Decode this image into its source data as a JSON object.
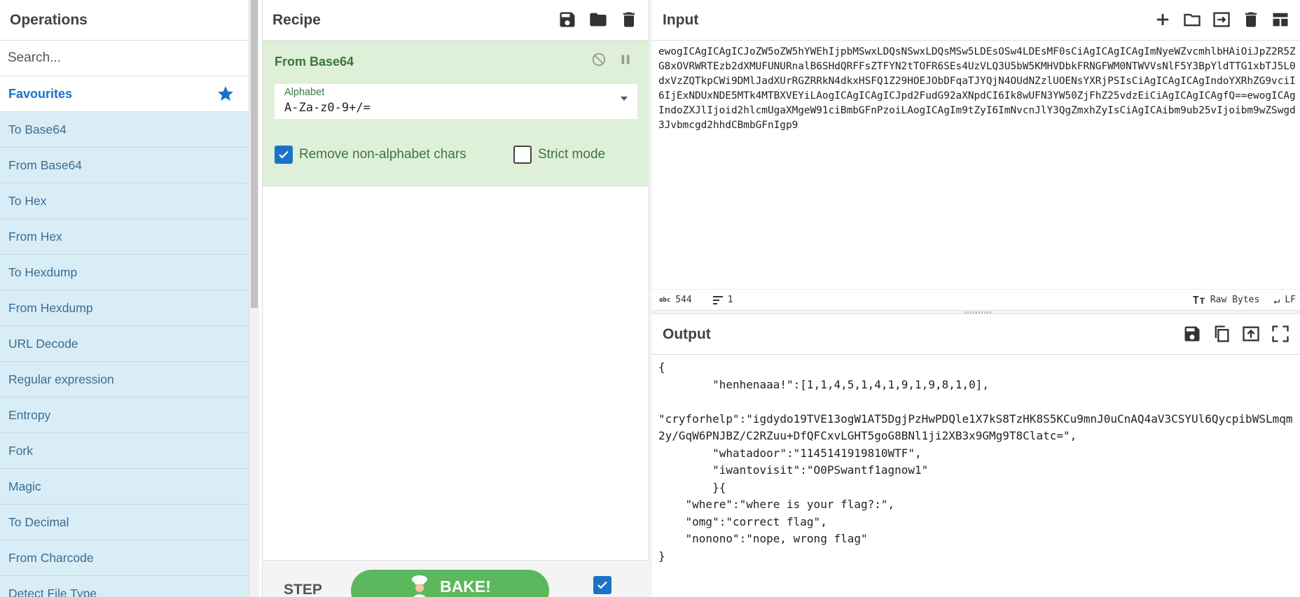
{
  "operations": {
    "title": "Operations",
    "search_placeholder": "Search...",
    "favourites_label": "Favourites",
    "items": [
      "To Base64",
      "From Base64",
      "To Hex",
      "From Hex",
      "To Hexdump",
      "From Hexdump",
      "URL Decode",
      "Regular expression",
      "Entropy",
      "Fork",
      "Magic",
      "To Decimal",
      "From Charcode",
      "Detect File Type"
    ]
  },
  "recipe": {
    "title": "Recipe",
    "operation": {
      "title": "From Base64",
      "alphabet_label": "Alphabet",
      "alphabet_value": "A-Za-z0-9+/=",
      "remove_non_alphabet_label": "Remove non-alphabet chars",
      "remove_non_alphabet_checked": true,
      "strict_mode_label": "Strict mode",
      "strict_mode_checked": false
    },
    "step_label": "STEP",
    "bake_label": "BAKE!",
    "auto_bake_checked": true
  },
  "input": {
    "title": "Input",
    "text": "ewogICAgICAgICJoZW5oZW5hYWEhIjpbMSwxLDQsNSwxLDQsMSw5LDEsOSw4LDEsMF0sCiAgICAgICAgImNyeWZvcmhlbHAiOiJpZ2R5ZG8xOVRWRTEzb2dXMUFUNURnalB6SHdQRFFsZTFYN2tTOFR6SEs4UzVLQ3U5bW5KMHVDbkFRNGFWM0NTWVVsNlF5Y3BpYldTTG1xbTJ5L0dxVzZQTkpCWi9DMlJadXUrRGZRRkN4dkxHSFQ1Z29HOEJObDFqaTJYQjN4OUdNZzlUOENsYXRjPSIsCiAgICAgICAgIndoYXRhZG9vciI6IjExNDUxNDE5MTk4MTBXVEYiLAogICAgICAgICJpd2FudG92aXNpdCI6Ik8wUFN3YW50ZjFhZ25vdzEiCiAgICAgICAgfQ==ewogICAgIndoZXJlIjoid2hlcmUgaXMgeW91ciBmbGFnPzoiLAogICAgIm9tZyI6ImNvcnJlY3QgZmxhZyIsCiAgICAibm9ub25vIjoibm9wZSwgd3Jvbmcgd2hhdCBmbGFnIgp9",
    "char_count": "544",
    "line_count": "1",
    "encoding_label": "Raw Bytes",
    "eol_label": "LF"
  },
  "output": {
    "title": "Output",
    "text": "{\n        \"henhenaaa!\":[1,1,4,5,1,4,1,9,1,9,8,1,0],\n\n\"cryforhelp\":\"igdydo19TVE13ogW1AT5DgjPzHwPDQle1X7kS8TzHK8S5KCu9mnJ0uCnAQ4aV3CSYUl6QycpibWSLmqm2y/GqW6PNJBZ/C2RZuu+DfQFCxvLGHT5goG8BNl1ji2XB3x9GMg9T8Clatc=\",\n        \"whatadoor\":\"1145141919810WTF\",\n        \"iwantovisit\":\"O0PSwantf1agnow1\"\n        }{\n    \"where\":\"where is your flag?:\",\n    \"omg\":\"correct flag\",\n    \"nonono\":\"nope, wrong flag\"\n}"
  },
  "colors": {
    "accent": "#1a73c8",
    "op_item_bg": "#d9edf7",
    "recipe_card_bg": "#dff0d8",
    "recipe_text": "#3c763d",
    "bake_button": "#5cb85c"
  }
}
